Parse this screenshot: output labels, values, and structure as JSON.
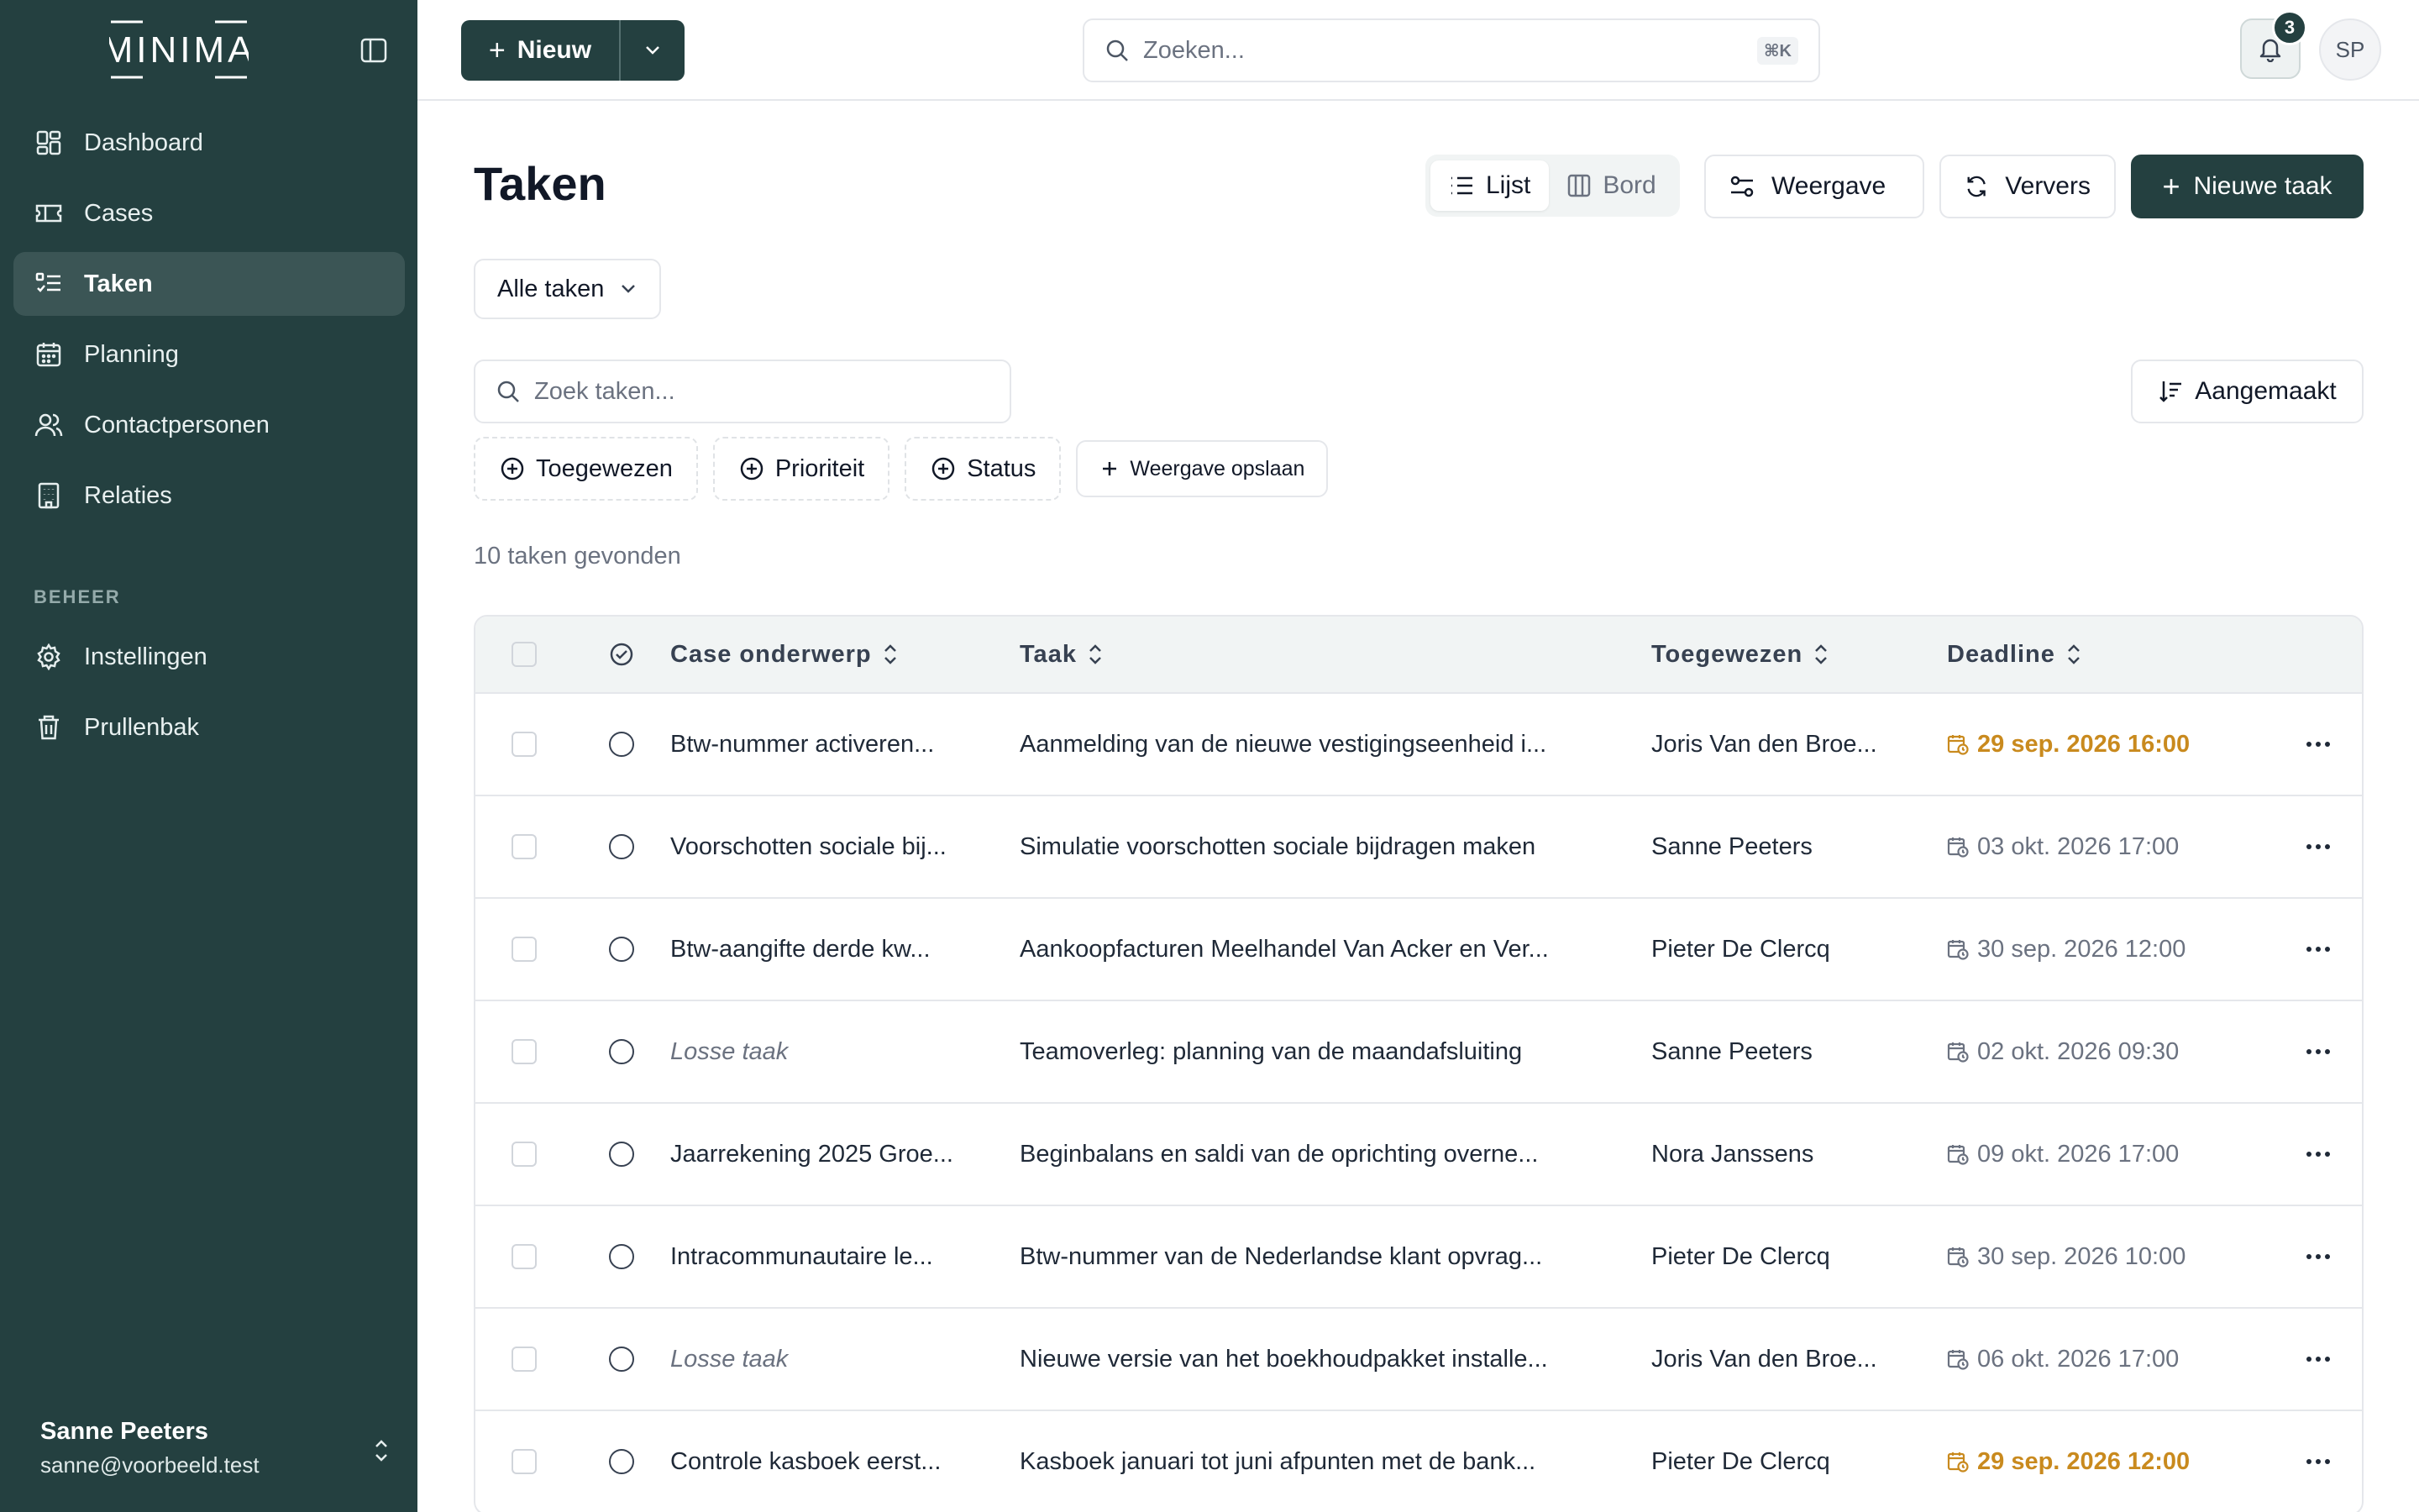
{
  "app": {
    "logo_text": "MINIMA",
    "colors": {
      "brand": "#244040",
      "warning": "#c98a1e"
    }
  },
  "sidebar": {
    "items": [
      {
        "label": "Dashboard",
        "icon": "dashboard-icon",
        "active": false
      },
      {
        "label": "Cases",
        "icon": "ticket-icon",
        "active": false
      },
      {
        "label": "Taken",
        "icon": "task-list-icon",
        "active": true
      },
      {
        "label": "Planning",
        "icon": "calendar-icon",
        "active": false
      },
      {
        "label": "Contactpersonen",
        "icon": "users-icon",
        "active": false
      },
      {
        "label": "Relaties",
        "icon": "building-icon",
        "active": false
      }
    ],
    "section_label": "BEHEER",
    "admin_items": [
      {
        "label": "Instellingen",
        "icon": "gear-icon"
      },
      {
        "label": "Prullenbak",
        "icon": "trash-icon"
      }
    ],
    "user": {
      "name": "Sanne Peeters",
      "email": "sanne@voorbeeld.test"
    }
  },
  "topbar": {
    "new_label": "Nieuw",
    "search_placeholder": "Zoeken...",
    "search_shortcut": "⌘K",
    "notification_count": "3",
    "avatar_initials": "SP"
  },
  "main": {
    "title": "Taken",
    "view_toggle": {
      "list": "Lijst",
      "board": "Bord"
    },
    "view_button": "Weergave",
    "refresh_button": "Ververs",
    "new_task_button": "Nieuwe taak",
    "filter_select": "Alle taken",
    "task_search_placeholder": "Zoek taken...",
    "sort_button": "Aangemaakt",
    "chips": {
      "assigned": "Toegewezen",
      "priority": "Prioriteit",
      "status": "Status",
      "save_view": "Weergave opslaan"
    },
    "count_text": "10 taken gevonden"
  },
  "table": {
    "headers": {
      "case": "Case onderwerp",
      "task": "Taak",
      "assignee": "Toegewezen",
      "deadline": "Deadline"
    },
    "rows": [
      {
        "case": "Btw-nummer activeren...",
        "case_italic": false,
        "task": "Aanmelding van de nieuwe vestigingseenheid i...",
        "assignee": "Joris Van den Broe...",
        "deadline": "29 sep. 2026 16:00",
        "overdue": true
      },
      {
        "case": "Voorschotten sociale bij...",
        "case_italic": false,
        "task": "Simulatie voorschotten sociale bijdragen maken",
        "assignee": "Sanne Peeters",
        "deadline": "03 okt. 2026 17:00",
        "overdue": false
      },
      {
        "case": "Btw-aangifte derde kw...",
        "case_italic": false,
        "task": "Aankoopfacturen Meelhandel Van Acker en Ver...",
        "assignee": "Pieter De Clercq",
        "deadline": "30 sep. 2026 12:00",
        "overdue": false
      },
      {
        "case": "Losse taak",
        "case_italic": true,
        "task": "Teamoverleg: planning van de maandafsluiting",
        "assignee": "Sanne Peeters",
        "deadline": "02 okt. 2026 09:30",
        "overdue": false
      },
      {
        "case": "Jaarrekening 2025 Groe...",
        "case_italic": false,
        "task": "Beginbalans en saldi van de oprichting overne...",
        "assignee": "Nora Janssens",
        "deadline": "09 okt. 2026 17:00",
        "overdue": false
      },
      {
        "case": "Intracommunautaire le...",
        "case_italic": false,
        "task": "Btw-nummer van de Nederlandse klant opvrag...",
        "assignee": "Pieter De Clercq",
        "deadline": "30 sep. 2026 10:00",
        "overdue": false
      },
      {
        "case": "Losse taak",
        "case_italic": true,
        "task": "Nieuwe versie van het boekhoudpakket installe...",
        "assignee": "Joris Van den Broe...",
        "deadline": "06 okt. 2026 17:00",
        "overdue": false
      },
      {
        "case": "Controle kasboek eerst...",
        "case_italic": false,
        "task": "Kasboek januari tot juni afpunten met de bank...",
        "assignee": "Pieter De Clercq",
        "deadline": "29 sep. 2026 12:00",
        "overdue": true
      }
    ]
  }
}
